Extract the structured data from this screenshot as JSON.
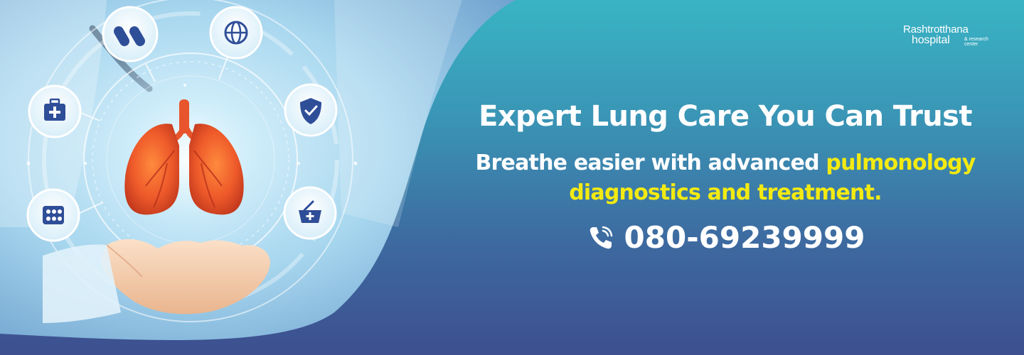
{
  "brand": {
    "name": "Rashtrotthana",
    "hospital": "hospital",
    "research": "& research center"
  },
  "hero": {
    "headline": "Expert Lung Care You Can Trust",
    "sub_white": "Breathe easier with advanced ",
    "sub_yellow": "pulmonology diagnostics and treatment.",
    "phone": "080-69239999"
  },
  "icons": [
    "capsules-icon",
    "globe-icon",
    "first-aid-kit-icon",
    "shield-check-icon",
    "pill-pack-icon",
    "medical-basket-icon",
    "lungs-icon",
    "hand-icon",
    "phone-icon"
  ],
  "colors": {
    "teal_top": "#39b4c4",
    "navy_bottom": "#3d4f8f",
    "accent_yellow": "#f3ea12",
    "lung_orange": "#e8552d"
  }
}
